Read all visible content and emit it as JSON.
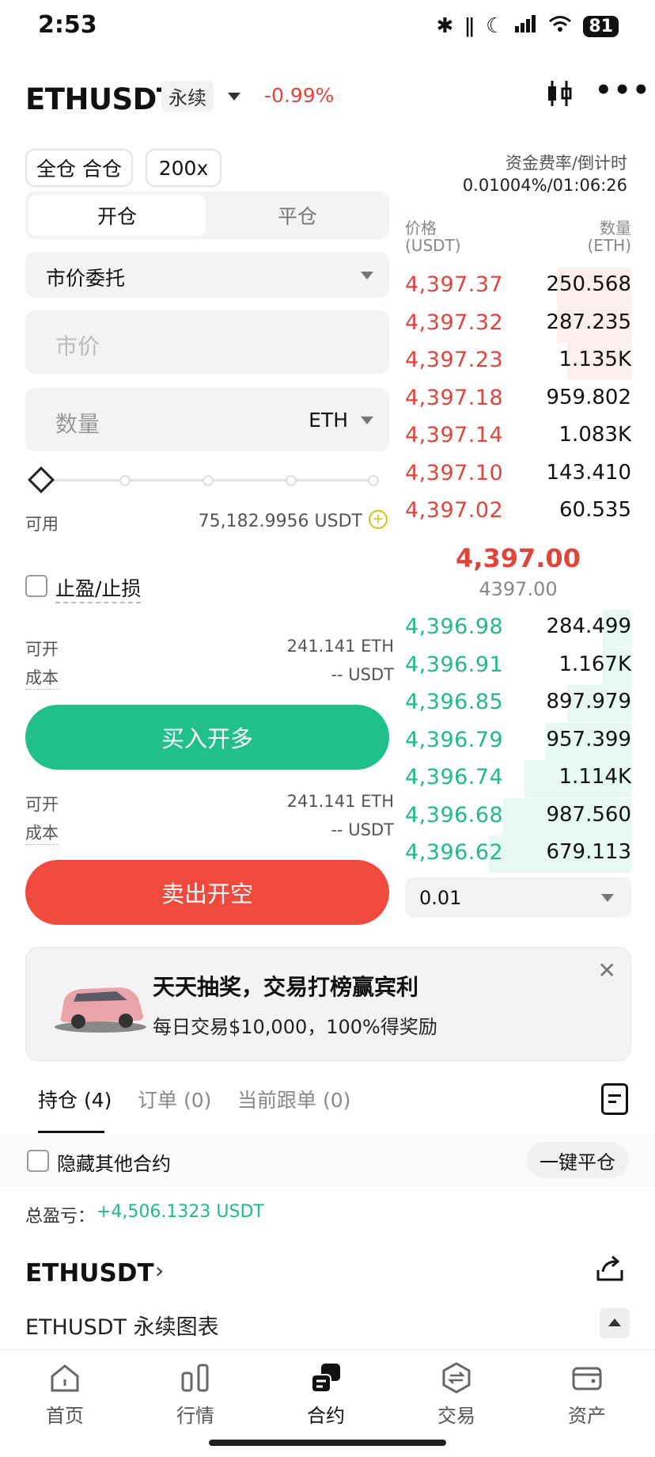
{
  "status_bar": {
    "time": "2:53",
    "battery": "81"
  },
  "header": {
    "symbol": "ETHUSDT",
    "contract_type": "永续",
    "change": "-0.99%"
  },
  "controls": {
    "margin_mode": "全仓 合仓",
    "leverage": "200x"
  },
  "funding": {
    "label": "资金费率/倒计时",
    "value": "0.01004%/01:06:26"
  },
  "tabs": {
    "open": "开仓",
    "close": "平仓"
  },
  "order_type": "市价委托",
  "price_field": {
    "placeholder": "市价"
  },
  "qty_field": {
    "placeholder": "数量",
    "unit": "ETH"
  },
  "slider": {
    "level": 0
  },
  "available": {
    "label": "可用",
    "value": "75,182.9956 USDT"
  },
  "tpsl": {
    "label": "止盈/止损"
  },
  "buy": {
    "can_open_label": "可开",
    "can_open_value": "241.141 ETH",
    "cost_label": "成本",
    "cost_value": "-- USDT",
    "button": "买入开多"
  },
  "sell": {
    "can_open_label": "可开",
    "can_open_value": "241.141 ETH",
    "cost_label": "成本",
    "cost_value": "-- USDT",
    "button": "卖出开空"
  },
  "orderbook": {
    "price_header": "价格",
    "price_unit": "(USDT)",
    "qty_header": "数量",
    "qty_unit": "(ETH)",
    "asks": [
      {
        "price": "4,397.37",
        "qty": "250.568",
        "depth": 0.52
      },
      {
        "price": "4,397.32",
        "qty": "287.235",
        "depth": 0.52
      },
      {
        "price": "4,397.23",
        "qty": "1.135K",
        "depth": 0.45
      },
      {
        "price": "4,397.18",
        "qty": "959.802",
        "depth": 0.0
      },
      {
        "price": "4,397.14",
        "qty": "1.083K",
        "depth": 0.0
      },
      {
        "price": "4,397.10",
        "qty": "143.410",
        "depth": 0.0
      },
      {
        "price": "4,397.02",
        "qty": "60.535",
        "depth": 0.0
      }
    ],
    "last_price": "4,397.00",
    "mark_price": "4397.00",
    "bids": [
      {
        "price": "4,396.98",
        "qty": "284.499",
        "depth": 0.2
      },
      {
        "price": "4,396.91",
        "qty": "1.167K",
        "depth": 0.2
      },
      {
        "price": "4,396.85",
        "qty": "897.979",
        "depth": 0.45
      },
      {
        "price": "4,396.79",
        "qty": "957.399",
        "depth": 0.6
      },
      {
        "price": "4,396.74",
        "qty": "1.114K",
        "depth": 0.75
      },
      {
        "price": "4,396.68",
        "qty": "987.560",
        "depth": 0.9
      },
      {
        "price": "4,396.62",
        "qty": "679.113",
        "depth": 1.0
      }
    ],
    "precision": "0.01"
  },
  "banner": {
    "title": "天天抽奖，交易打榜赢宾利",
    "subtitle": "每日交易$10,000，100%得奖励"
  },
  "positions_tabs": {
    "positions": "持仓 (4)",
    "orders": "订单 (0)",
    "copy": "当前跟单 (0)"
  },
  "hide_other": "隐藏其他合约",
  "close_all": "一键平仓",
  "total_pnl": {
    "label": "总盈亏：",
    "value": "+4,506.1323 USDT"
  },
  "position": {
    "symbol": "ETHUSDT"
  },
  "chart_bar": {
    "label": "ETHUSDT 永续图表"
  },
  "nav": {
    "home": "首页",
    "market": "行情",
    "futures": "合约",
    "trade": "交易",
    "assets": "资产"
  },
  "colors": {
    "red": "#e0453c",
    "green": "#21b98a",
    "buy_button": "#21bf8c",
    "sell_button": "#f04a3e"
  }
}
